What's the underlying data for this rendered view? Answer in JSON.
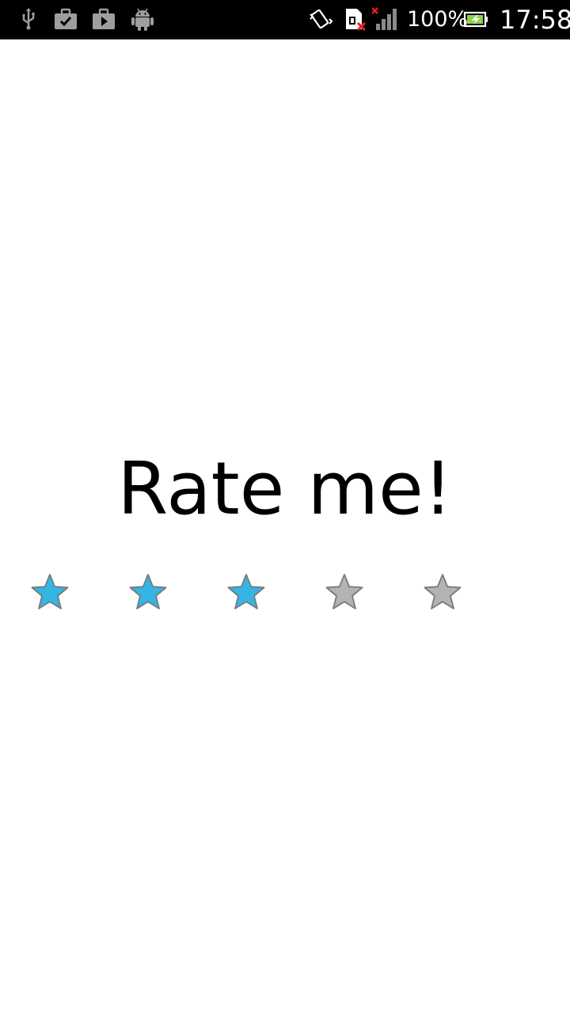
{
  "status_bar": {
    "left_icons": [
      "usb-icon",
      "briefcase-check-icon",
      "briefcase-play-icon",
      "android-icon"
    ],
    "right_icons": [
      "vibrate-icon",
      "sim-error-icon",
      "signal-no-service-icon",
      "battery-charging-icon"
    ],
    "battery_percent": "100%",
    "time": "17:58"
  },
  "main": {
    "title": "Rate me!"
  },
  "rating": {
    "value": 3,
    "max": 5,
    "filled_color": "#33b5e5",
    "empty_color": "#b3b3b3"
  }
}
